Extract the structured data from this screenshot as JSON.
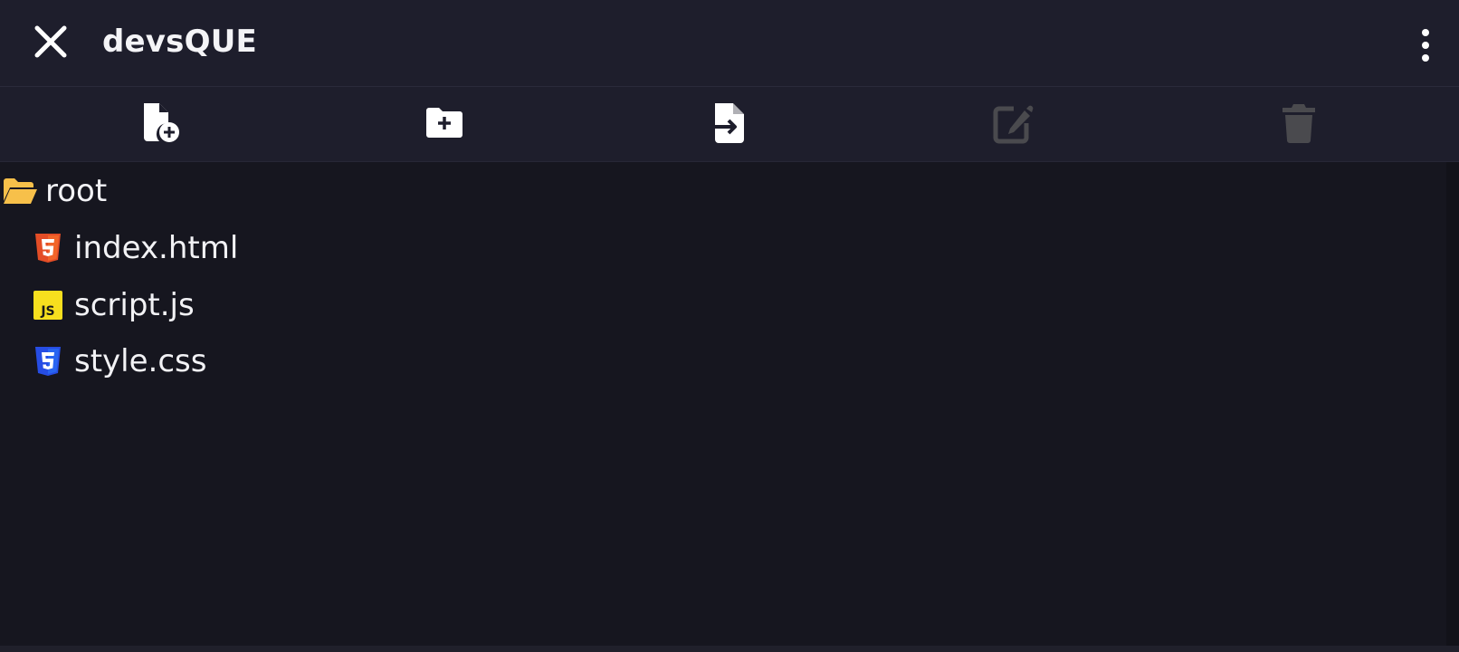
{
  "header": {
    "title": "devsQUE",
    "close_icon": "close-icon",
    "menu_icon": "more-vertical-icon"
  },
  "toolbar": {
    "actions": [
      {
        "name": "new-file",
        "icon": "file-add-icon",
        "enabled": true
      },
      {
        "name": "new-folder",
        "icon": "folder-add-icon",
        "enabled": true
      },
      {
        "name": "import-file",
        "icon": "file-import-icon",
        "enabled": true
      },
      {
        "name": "rename",
        "icon": "edit-icon",
        "enabled": false
      },
      {
        "name": "delete",
        "icon": "trash-icon",
        "enabled": false
      }
    ]
  },
  "tree": {
    "root": {
      "label": "root",
      "icon": "folder-open-icon",
      "expanded": true
    },
    "files": [
      {
        "label": "index.html",
        "icon": "html5-icon"
      },
      {
        "label": "script.js",
        "icon": "javascript-icon"
      },
      {
        "label": "style.css",
        "icon": "css3-icon"
      }
    ]
  },
  "colors": {
    "header_bg": "#1e1e2c",
    "panel_bg": "#16161f",
    "text": "#f2f2f5",
    "icon_enabled": "#ffffff",
    "icon_disabled": "#4a4a4e",
    "folder": "#f7c04a",
    "html": "#e44d26",
    "js": "#f7df1e",
    "css": "#264de4"
  }
}
